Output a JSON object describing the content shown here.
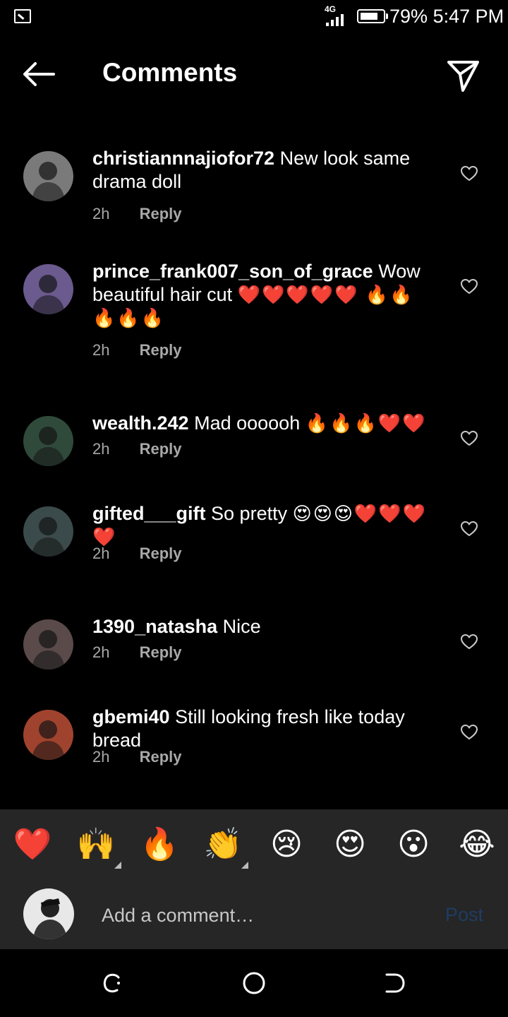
{
  "status_bar": {
    "network": "4G",
    "battery_level": 0.79,
    "battery_text": "79%",
    "time": "5:47 PM"
  },
  "header": {
    "title": "Comments",
    "back_icon": "arrow-left-icon",
    "share_icon": "paper-plane-icon"
  },
  "comments": [
    {
      "username": "christiannnajiofor72",
      "text": "New look same drama doll",
      "emoji": "",
      "time": "2h",
      "reply": "Reply",
      "avatar_color": "#7a7a7a"
    },
    {
      "username": "prince_frank007_son_of_grace",
      "text": "Wow beautiful hair cut",
      "emoji": "❤️❤️❤️❤️❤️ 🔥🔥🔥🔥🔥",
      "time": "2h",
      "reply": "Reply",
      "avatar_color": "#6b5a8e"
    },
    {
      "username": "wealth.242",
      "text": "Mad oooooh",
      "emoji": "🔥🔥🔥❤️❤️",
      "time": "2h",
      "reply": "Reply",
      "avatar_color": "#2f4a3a"
    },
    {
      "username": "gifted___gift",
      "text": "So pretty",
      "emoji": "😍😍😍❤️❤️❤️❤️",
      "time": "2h",
      "reply": "Reply",
      "avatar_color": "#3b4a4a"
    },
    {
      "username": "1390_natasha",
      "text": "Nice",
      "emoji": "",
      "time": "2h",
      "reply": "Reply",
      "avatar_color": "#5a4a4a"
    },
    {
      "username": "gbemi40",
      "text": "Still looking fresh like today bread",
      "emoji": "",
      "time": "2h",
      "reply": "Reply",
      "avatar_color": "#a0432e"
    }
  ],
  "reactions": [
    "❤️",
    "🙌",
    "🔥",
    "👏",
    "😢",
    "😍",
    "😮",
    "😂"
  ],
  "composer": {
    "placeholder": "Add a comment…",
    "post_label": "Post"
  },
  "nav_bar": {
    "recent_icon": "recent-apps-icon",
    "home_icon": "home-circle-icon",
    "back_icon": "back-bracket-icon"
  }
}
